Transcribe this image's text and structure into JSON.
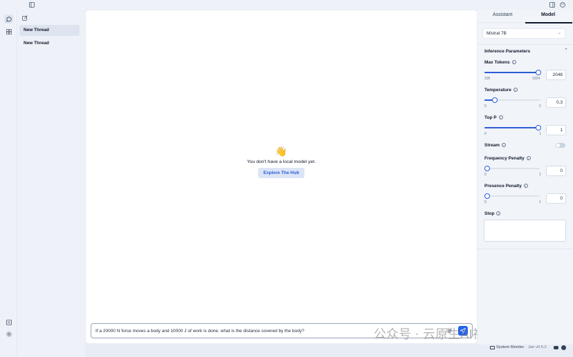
{
  "sidebar": {
    "threads": [
      {
        "label": "New Thread",
        "active": true
      },
      {
        "label": "New Thread",
        "active": false
      }
    ],
    "icons": [
      "chat-icon",
      "grid-icon",
      "compose-icon",
      "monitor-icon",
      "settings-icon"
    ]
  },
  "main": {
    "emoji": "👋",
    "empty_message": "You don't have a local model yet.",
    "hub_button": "Explore The Hub",
    "composer_text": "If a 20000 N force moves a body and 10000 J of work is done, what is the distance covered by the body?"
  },
  "right_panel": {
    "tabs": [
      {
        "label": "Assistant",
        "active": false
      },
      {
        "label": "Model",
        "active": true
      }
    ],
    "model_select": "Mistral 7B",
    "section_title": "Inference Parameters",
    "params": {
      "max_tokens": {
        "label": "Max Tokens",
        "value": "2048",
        "min": "100",
        "max": "1024",
        "level": 1.0
      },
      "temperature": {
        "label": "Temperature",
        "value": "0,3",
        "min": "0",
        "max": "2",
        "level": 0.15
      },
      "top_p": {
        "label": "Top P",
        "value": "1",
        "min": "0",
        "max": "1",
        "level": 1.0
      },
      "stream": {
        "label": "Stream",
        "enabled": false
      },
      "frequency_penalty": {
        "label": "Frequency Penalty",
        "value": "0",
        "min": "0",
        "max": "1",
        "level": 0.0
      },
      "presence_penalty": {
        "label": "Presence Penalty",
        "value": "0",
        "min": "0",
        "max": "1",
        "level": 0.0
      },
      "stop": {
        "label": "Stop",
        "value": ""
      }
    }
  },
  "statusbar": {
    "system_monitor": "System Monitor",
    "version": "Jan v0.5.2"
  },
  "watermark": "公众号 · 云原生AI视界",
  "colors": {
    "accent": "#2b5bd7",
    "send": "#2563eb"
  }
}
